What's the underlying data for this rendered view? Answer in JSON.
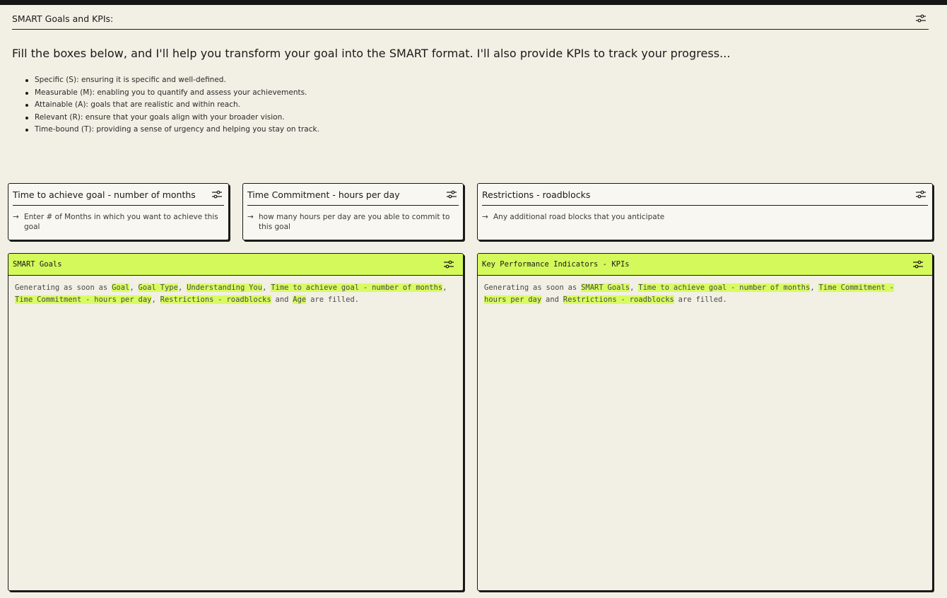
{
  "header": {
    "title": "SMART Goals and KPIs:",
    "icon": "sliders-icon"
  },
  "intro": "Fill the boxes below, and I'll help you transform your goal into the SMART format. I'll also provide KPIs to track your progress...",
  "criteria": [
    "Specific (S): ensuring it is specific and well-defined.",
    "Measurable (M): enabling you to quantify and assess your achievements.",
    "Attainable (A): goals that are realistic and within reach.",
    "Relevant (R): ensure that your goals align with your broader vision.",
    "Time-bound (T): providing a sense of urgency and helping you stay on track."
  ],
  "inputs": [
    {
      "label": "Time to achieve goal - number of months",
      "placeholder": "Enter # of Months in which you want to achieve this goal"
    },
    {
      "label": "Time Commitment - hours per day",
      "placeholder": "how many hours per day are you able to commit to this goal"
    },
    {
      "label": "Restrictions - roadblocks",
      "placeholder": "Any additional road blocks that you anticipate"
    }
  ],
  "arrow_glyph": "→",
  "smart_goals": {
    "title": "SMART Goals",
    "prefix": "Generating as soon as",
    "dependencies": [
      "Goal",
      "Goal Type",
      "Understanding You",
      "Time to achieve goal - number of months",
      "Time Commitment - hours per day",
      "Restrictions - roadblocks",
      "Age"
    ],
    "suffix": "are filled."
  },
  "kpis": {
    "title": "Key Performance Indicators - KPIs",
    "prefix": "Generating as soon as",
    "dependencies": [
      "SMART Goals",
      "Time to achieve goal - number of months",
      "Time Commitment - hours per day",
      "Restrictions - roadblocks"
    ],
    "suffix": "are filled."
  },
  "colors": {
    "accent": "#d4f95a",
    "background": "#f2efe4",
    "card": "#f8f7f1",
    "border": "#1a1a1a"
  },
  "separators": {
    "comma": ", ",
    "and": " and "
  }
}
